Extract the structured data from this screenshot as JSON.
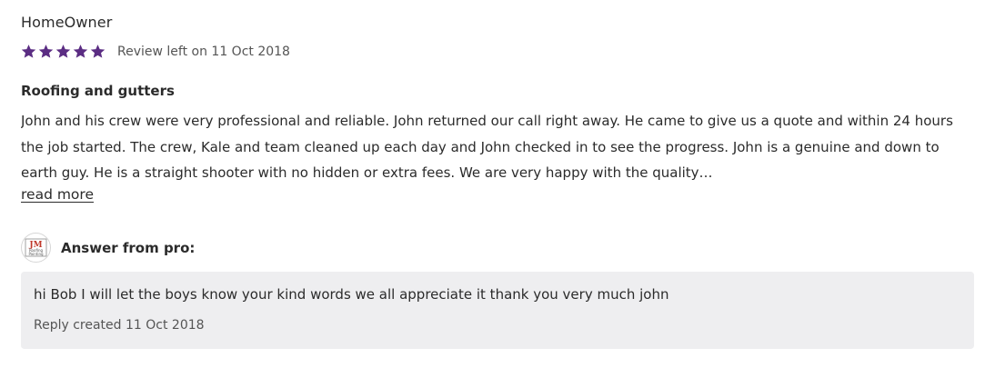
{
  "reviewer": {
    "name": "HomeOwner"
  },
  "rating": {
    "stars": 5,
    "max_stars": 5,
    "star_color": "#5b2d83",
    "icon": "star-icon"
  },
  "review": {
    "date_text": "Review left on 11 Oct 2018",
    "title": "Roofing and gutters",
    "body": "John and his crew were very professional and reliable. John returned our call right away. He came to give us a quote and within 24 hours the job started. The crew, Kale and team cleaned up each day and John checked in to see the progress. John is a genuine and down to earth guy. He is a straight shooter with no hidden or extra fees. We are very happy with the quality…",
    "read_more_label": "read more"
  },
  "answer": {
    "header_label": "Answer from pro:",
    "avatar": {
      "logo_text": "JM",
      "logo_subtext_1": "Roofing",
      "logo_subtext_2": "Painting",
      "logo_color": "#c0392b"
    },
    "reply_text": "hi Bob I will let the boys know your kind words we all appreciate it thank you very much john",
    "reply_date_text": "Reply created 11 Oct 2018",
    "background_color": "#eeeef0"
  }
}
